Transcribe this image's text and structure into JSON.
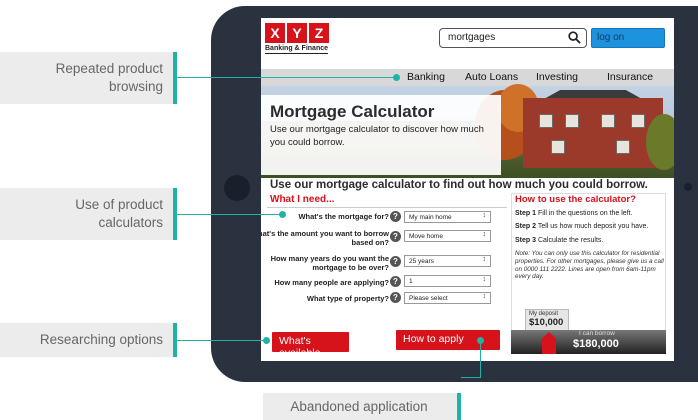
{
  "callouts": {
    "browsing": "Repeated product browsing",
    "calculators": "Use of product calculators",
    "researching": "Researching options",
    "abandoned": "Abandoned application"
  },
  "brand": {
    "letters": [
      "X",
      "Y",
      "Z"
    ],
    "tagline": "Banking & Finance",
    "red": "#d6121b",
    "accent_teal": "#1fb3a8",
    "logon_blue": "#1d93e0"
  },
  "header": {
    "search_value": "mortgages",
    "logon_label": "log on"
  },
  "nav": [
    "Banking",
    "Auto Loans",
    "Investing",
    "Insurance"
  ],
  "hero": {
    "title": "Mortgage Calculator",
    "text": "Use our mortgage calculator to discover how much you could borrow."
  },
  "headline": "Use our mortgage calculator to find out how much you could borrow.",
  "form": {
    "title": "What I need...",
    "questions": [
      {
        "label": "What's the mortgage for?",
        "value": "My main home"
      },
      {
        "label": "What's the amount you want to borrow based on?",
        "value": "Move home"
      },
      {
        "label": "How many years do you want the mortgage to be over?",
        "value": "25 years"
      },
      {
        "label": "How many people are applying?",
        "value": "1"
      },
      {
        "label": "What type of property?",
        "value": "Please select"
      }
    ],
    "help_glyph": "?",
    "whats_available": "What's available",
    "how_to_apply": "How to apply"
  },
  "howto": {
    "title": "How to use the calculator?",
    "steps": [
      {
        "num": "Step 1",
        "text": "Fill in the questions on the left."
      },
      {
        "num": "Step 2",
        "text": "Tell us how much deposit you have."
      },
      {
        "num": "Step 3",
        "text": "Calculate the results."
      }
    ],
    "note": "Note: You can only use this calculator for residential properties. For other mortgages, please give us a call on 0000 111 2222. Lines are open from 6am-11pm every day."
  },
  "calculator": {
    "deposit_label": "My deposit",
    "deposit_value": "$10,000",
    "borrow_label": "I can borrow",
    "borrow_value": "$180,000"
  }
}
